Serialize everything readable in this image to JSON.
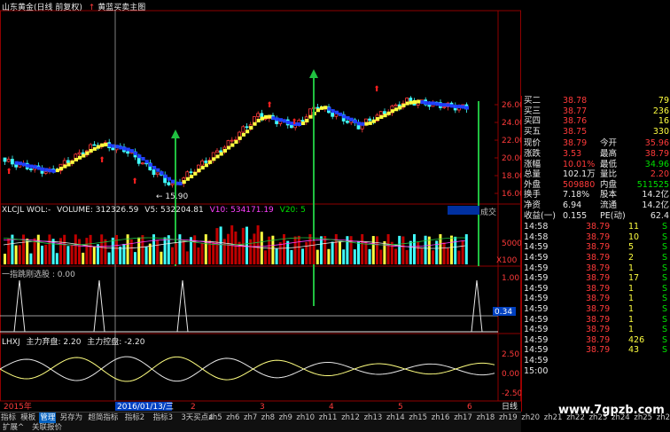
{
  "main_chart": {
    "title": "山东黄金(日线 前复权)",
    "indicator_name": "黄蓝买卖主图",
    "price_axis": [
      "26.00",
      "24.00",
      "22.00",
      "20.00",
      "18.00",
      "16.00"
    ],
    "low_label": "15.90"
  },
  "volume_pane": {
    "title": "XLCJL WOL:-",
    "volume": "VOLUME: 312326.59",
    "v5": "V5: 532204.81",
    "v10": "V10: 534171.19",
    "v20": "V20: 5",
    "right_label": "成交",
    "axis": [
      "5000",
      "X100"
    ]
  },
  "signal_pane": {
    "title": "一指跳刚选股 : 0.00",
    "axis_top": "1.00",
    "axis_value": "0.34"
  },
  "lhxj_pane": {
    "title": "LHXJ",
    "line1": "主力弃盘: 2.20",
    "line2": "主力控盘: -2.20",
    "axis": [
      "2.50",
      "0.00",
      "-2.50"
    ]
  },
  "date_axis": {
    "year": "2015年",
    "cursor_date": "2016/01/13/三",
    "marks": [
      "2",
      "3",
      "4",
      "5",
      "6"
    ],
    "right_label": "日线"
  },
  "quote": {
    "bids": [
      {
        "label": "买二",
        "price": "38.78",
        "vol": "79"
      },
      {
        "label": "买三",
        "price": "38.77",
        "vol": "236"
      },
      {
        "label": "买四",
        "price": "38.76",
        "vol": "16"
      },
      {
        "label": "买五",
        "price": "38.75",
        "vol": "330"
      }
    ],
    "stats": [
      {
        "l1": "现价",
        "v1": "38.79",
        "l2": "今开",
        "v2": "35.96"
      },
      {
        "l1": "涨跌",
        "v1": "3.53",
        "l2": "最高",
        "v2": "38.79"
      },
      {
        "l1": "涨幅",
        "v1": "10.01%",
        "l2": "最低",
        "v2": "34.96"
      },
      {
        "l1": "总量",
        "v1": "102.1万",
        "l2": "量比",
        "v2": "2.20"
      },
      {
        "l1": "外盘",
        "v1": "509880",
        "l2": "内盘",
        "v2": "511525"
      },
      {
        "l1": "换手",
        "v1": "7.18%",
        "l2": "股本",
        "v2": "14.2亿"
      },
      {
        "l1": "净资",
        "v1": "6.94",
        "l2": "流通",
        "v2": "14.2亿"
      },
      {
        "l1": "收益(一)",
        "v1": "0.155",
        "l2": "PE(动)",
        "v2": "62.4"
      }
    ],
    "ticks": [
      {
        "time": "14:58",
        "price": "38.79",
        "vol": "11",
        "side": "S"
      },
      {
        "time": "14:58",
        "price": "38.79",
        "vol": "10",
        "side": "S"
      },
      {
        "time": "14:59",
        "price": "38.79",
        "vol": "5",
        "side": "S"
      },
      {
        "time": "14:59",
        "price": "38.79",
        "vol": "2",
        "side": "S"
      },
      {
        "time": "14:59",
        "price": "38.79",
        "vol": "1",
        "side": "S"
      },
      {
        "time": "14:59",
        "price": "38.79",
        "vol": "17",
        "side": "S"
      },
      {
        "time": "14:59",
        "price": "38.79",
        "vol": "1",
        "side": "S"
      },
      {
        "time": "14:59",
        "price": "38.79",
        "vol": "1",
        "side": "S"
      },
      {
        "time": "14:59",
        "price": "38.79",
        "vol": "1",
        "side": "S"
      },
      {
        "time": "14:59",
        "price": "38.79",
        "vol": "1",
        "side": "S"
      },
      {
        "time": "14:59",
        "price": "38.79",
        "vol": "1",
        "side": "S"
      },
      {
        "time": "14:59",
        "price": "38.79",
        "vol": "426",
        "side": "S"
      },
      {
        "time": "14:59",
        "price": "38.79",
        "vol": "43",
        "side": "S"
      },
      {
        "time": "14:59",
        "price": "",
        "vol": "",
        "side": ""
      },
      {
        "time": "15:00",
        "price": "",
        "vol": "",
        "side": ""
      }
    ]
  },
  "tabs": [
    "指标",
    "模板",
    "管理",
    "另存为",
    "超简指标",
    "指标2",
    "指标3",
    "3天买点4",
    "zh5",
    "zh6",
    "zh7",
    "zh8",
    "zh9",
    "zh10",
    "zh11",
    "zh12",
    "zh13",
    "zh14",
    "zh15",
    "zh16",
    "zh17",
    "zh18",
    "zh19",
    "zh20",
    "zh21",
    "zh22",
    "zh23",
    "zh24",
    "zh25",
    "zh26",
    "zh27"
  ],
  "tabs2": [
    "扩展^",
    "关联报价"
  ],
  "watermark": "www.7gpzb.com"
}
